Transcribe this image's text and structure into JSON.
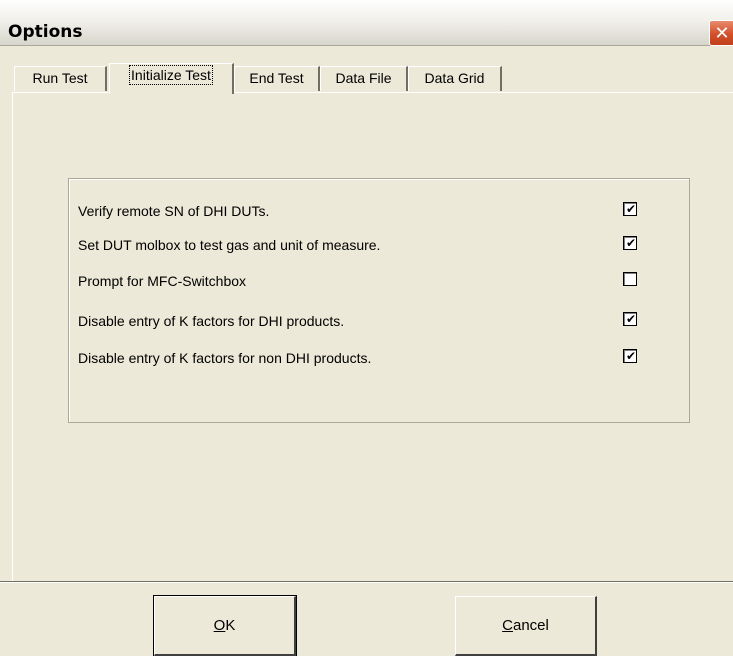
{
  "window": {
    "title": "Options",
    "close_glyph": "✕"
  },
  "tabs": [
    {
      "label": "Run Test",
      "active": false
    },
    {
      "label": "Initialize Test",
      "active": true
    },
    {
      "label": "End Test",
      "active": false
    },
    {
      "label": "Data File",
      "active": false
    },
    {
      "label": "Data Grid",
      "active": false
    }
  ],
  "options": [
    {
      "label": "Verify remote SN of DHI DUTs.",
      "checked": true
    },
    {
      "label": "Set DUT molbox to test gas and unit of measure.",
      "checked": true
    },
    {
      "label": "Prompt for MFC-Switchbox",
      "checked": false
    },
    {
      "label": "Disable entry of K factors for DHI products.",
      "checked": true
    },
    {
      "label": "Disable entry of K factors for non DHI products.",
      "checked": true
    }
  ],
  "buttons": {
    "ok": {
      "mnemonic": "O",
      "rest": "K"
    },
    "cancel": {
      "mnemonic": "C",
      "rest": "ancel"
    }
  },
  "checkmark_glyph": "✔"
}
